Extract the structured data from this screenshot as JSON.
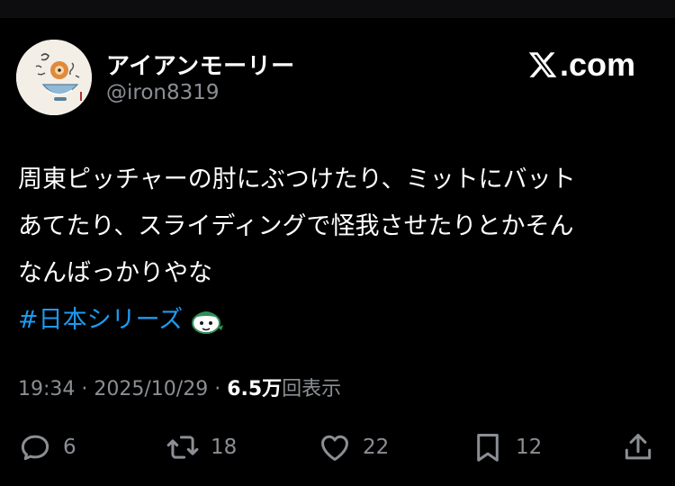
{
  "author": {
    "display_name": "アイアンモーリー",
    "handle": "@iron8319"
  },
  "brand": {
    "icon": "x-logo-icon",
    "text": ".com"
  },
  "tweet": {
    "lines": [
      "周東ピッチャーの肘にぶつけたり、ミットにバット",
      "あてたり、スライディングで怪我させたりとかそん",
      "なんばっかりやな"
    ],
    "hashtag": "#日本シリーズ",
    "hashflag_icon": "hashflag-mascot-icon"
  },
  "meta": {
    "time": "19:34",
    "separator_1": " · ",
    "date": "2025/10/29",
    "separator_2": " · ",
    "views_count": "6.5万",
    "views_label": "回表示"
  },
  "actions": {
    "reply": {
      "icon": "reply-icon",
      "count": "6"
    },
    "retweet": {
      "icon": "retweet-icon",
      "count": "18"
    },
    "like": {
      "icon": "heart-icon",
      "count": "22"
    },
    "bookmark": {
      "icon": "bookmark-icon",
      "count": "12"
    },
    "share": {
      "icon": "share-icon"
    }
  },
  "colors": {
    "background": "#000000",
    "text": "#ffffff",
    "secondary": "#8b8f94",
    "link": "#1d9bf0"
  }
}
